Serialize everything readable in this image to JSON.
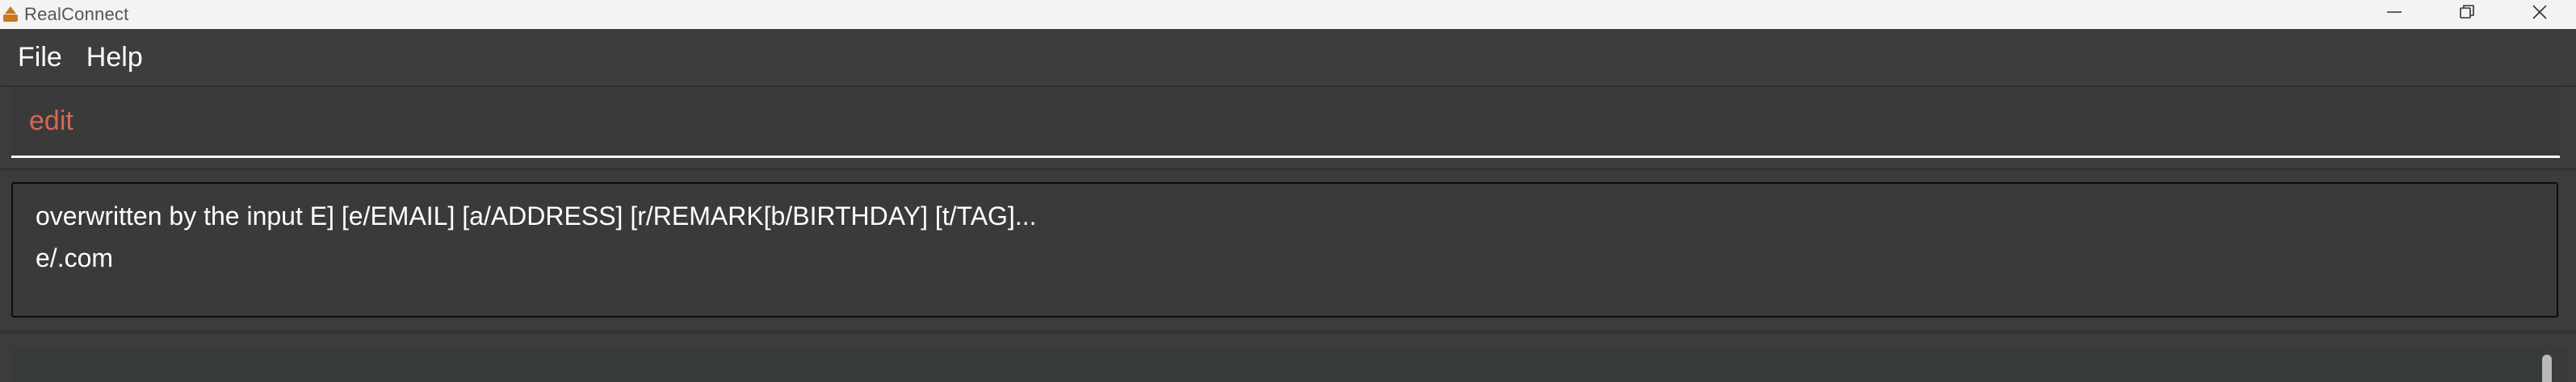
{
  "window": {
    "title": "RealConnect",
    "app_icon": "house-icon",
    "controls": [
      "minimize-icon",
      "restore-icon",
      "close-icon"
    ]
  },
  "menu": {
    "items": [
      {
        "label": "File"
      },
      {
        "label": "Help"
      }
    ]
  },
  "command_box": {
    "value": "edit",
    "text_color": "#d36a52"
  },
  "result_display": {
    "lines": [
      "overwritten by the input E] [e/EMAIL] [a/ADDRESS] [r/REMARK[b/BIRTHDAY] [t/TAG]...",
      "e/.com"
    ]
  },
  "colors": {
    "background": "#3c3c3c",
    "titlebar": "#f3f3f3",
    "text": "#ffffff",
    "list_panel": "#363c3a"
  }
}
